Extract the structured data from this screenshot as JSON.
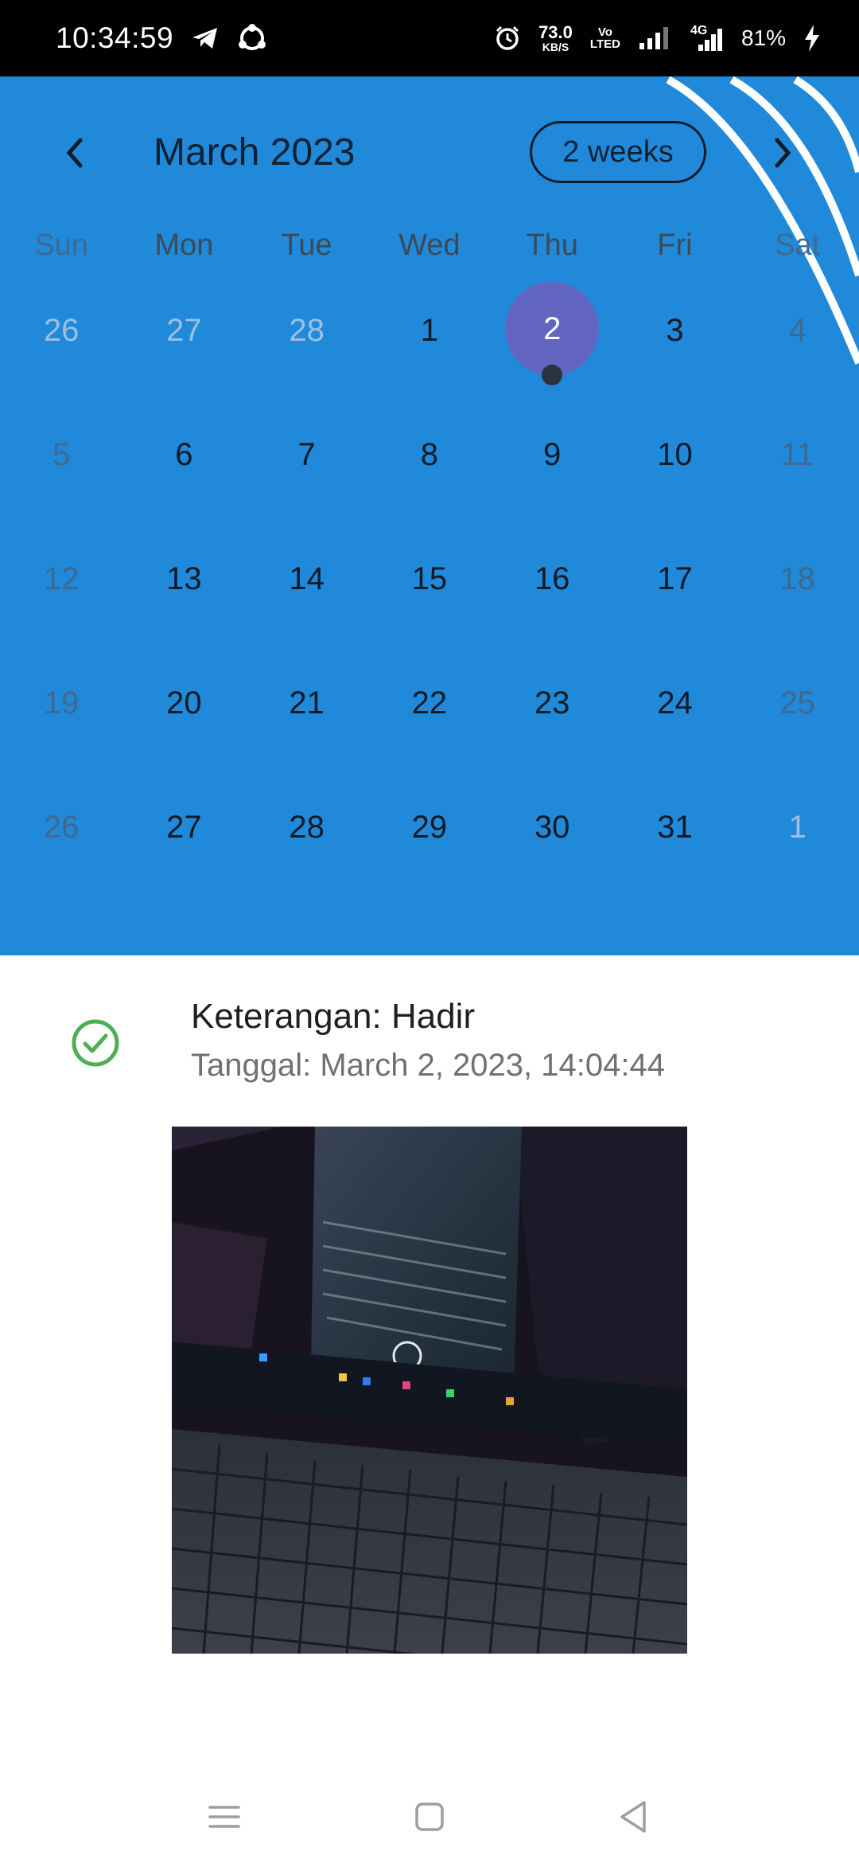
{
  "status_bar": {
    "time": "10:34:59",
    "net_speed_value": "73.0",
    "net_speed_unit": "KB/S",
    "volte_top": "Vo",
    "volte_bottom": "LTED",
    "network_type": "4G",
    "battery_percent": "81%",
    "icons": [
      "telegram-icon",
      "shareit-icon",
      "alarm-icon",
      "signal-icon",
      "signal-4g-icon",
      "charging-icon"
    ]
  },
  "calendar": {
    "month_title": "March 2023",
    "format_button": "2 weeks",
    "prev_icon": "chevron-left-icon",
    "next_icon": "chevron-right-icon",
    "weekdays": [
      "Sun",
      "Mon",
      "Tue",
      "Wed",
      "Thu",
      "Fri",
      "Sat"
    ],
    "weeks": [
      [
        "26",
        "27",
        "28",
        "1",
        "2",
        "3",
        "4"
      ],
      [
        "5",
        "6",
        "7",
        "8",
        "9",
        "10",
        "11"
      ],
      [
        "12",
        "13",
        "14",
        "15",
        "16",
        "17",
        "18"
      ],
      [
        "19",
        "20",
        "21",
        "22",
        "23",
        "24",
        "25"
      ],
      [
        "26",
        "27",
        "28",
        "29",
        "30",
        "31",
        "1"
      ]
    ],
    "selected_day": "2",
    "colors": {
      "background": "#2189d9",
      "selected": "#6266c1",
      "marker": "#2a333e"
    }
  },
  "event": {
    "status_icon": "check-circle-icon",
    "title": "Keterangan: Hadir",
    "date": "Tanggal: March 2, 2023, 14:04:44",
    "status_color": "#4caf50"
  },
  "photo": {
    "icon": "attendance-photo"
  },
  "nav_bar": {
    "icons": [
      "menu-icon",
      "home-icon",
      "back-icon"
    ]
  }
}
